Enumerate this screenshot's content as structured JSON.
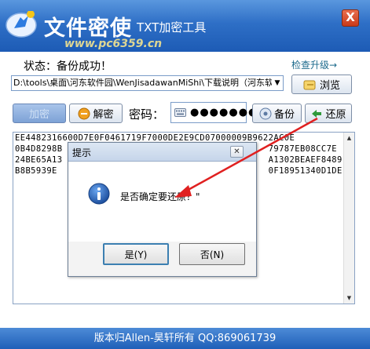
{
  "window": {
    "title_main": "文件密使",
    "title_sub": "TXT加密工具",
    "close_label": "X",
    "watermark": "www.pc6359.cn"
  },
  "status": {
    "text": "状态：备份成功！",
    "update_link": "检查升级→"
  },
  "path": {
    "value": "D:\\tools\\桌面\\河东软件园\\WenJisadawanMiShi\\下载说明（河东软",
    "browse_label": "浏览"
  },
  "actions": {
    "encrypt_label": "加密",
    "decrypt_label": "解密",
    "password_label": "密码：",
    "password_value": "●●●●●●●●",
    "backup_label": "备份",
    "restore_label": "还原"
  },
  "content": {
    "lines": [
      "EE4482316600D7E0F0461719F7000DE2E9CD07000009B9622AC0E",
      "0B4D8298B                                       79787EB08CC7E",
      "24BE65A13                                       A1302BEAEF8489",
      "B8B5939E                                        0F18951340D1DE"
    ]
  },
  "footer": {
    "text": "版本归Allen-昊轩所有  QQ:869061739"
  },
  "dialog": {
    "title": "提示",
    "close_label": "✕",
    "message": "是否确定要还原？\"",
    "yes_label": "是(Y)",
    "no_label": "否(N)"
  },
  "colors": {
    "titlebar": "#2e6fc6",
    "footer": "#1f5fb8",
    "annotation_arrow": "#e02020"
  }
}
